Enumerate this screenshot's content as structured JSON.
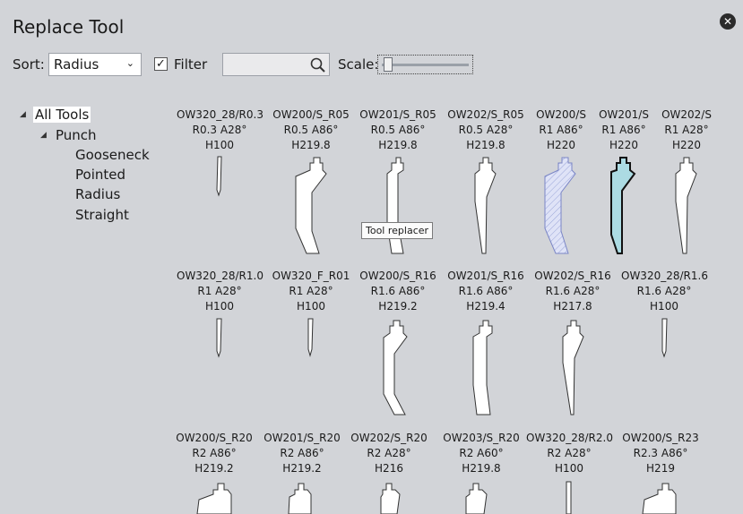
{
  "dialog": {
    "title": "Replace Tool",
    "close_glyph": "✕"
  },
  "toolbar": {
    "sort_label": "Sort:",
    "sort_value": "Radius",
    "filter_label": "Filter",
    "filter_checked": "✓",
    "search_value": "",
    "scale_label": "Scale:"
  },
  "tree": {
    "root": "All Tools",
    "group": "Punch",
    "children": [
      "Gooseneck",
      "Pointed",
      "Radius",
      "Straight"
    ]
  },
  "tooltip": "Tool replacer",
  "tools": [
    {
      "name": "OW320_28/R0.3",
      "spec": "R0.3  A28°",
      "height": "H100"
    },
    {
      "name": "OW200/S_R05",
      "spec": "R0.5  A86°",
      "height": "H219.8"
    },
    {
      "name": "OW201/S_R05",
      "spec": "R0.5  A86°",
      "height": "H219.8"
    },
    {
      "name": "OW202/S_R05",
      "spec": "R0.5  A28°",
      "height": "H219.8"
    },
    {
      "name": "OW200/S",
      "spec": "R1  A86°",
      "height": "H220"
    },
    {
      "name": "OW201/S",
      "spec": "R1  A86°",
      "height": "H220"
    },
    {
      "name": "OW202/S",
      "spec": "R1  A28°",
      "height": "H220"
    },
    {
      "name": "OW320_28/R1.0",
      "spec": "R1  A28°",
      "height": "H100"
    },
    {
      "name": "OW320_F_R01",
      "spec": "R1  A28°",
      "height": "H100"
    },
    {
      "name": "OW200/S_R16",
      "spec": "R1.6  A86°",
      "height": "H219.2"
    },
    {
      "name": "OW201/S_R16",
      "spec": "R1.6  A86°",
      "height": "H219.4"
    },
    {
      "name": "OW202/S_R16",
      "spec": "R1.6  A28°",
      "height": "H217.8"
    },
    {
      "name": "OW320_28/R1.6",
      "spec": "R1.6  A28°",
      "height": "H100"
    },
    {
      "name": "OW200/S_R20",
      "spec": "R2  A86°",
      "height": "H219.2"
    },
    {
      "name": "OW201/S_R20",
      "spec": "R2  A86°",
      "height": "H219.2"
    },
    {
      "name": "OW202/S_R20",
      "spec": "R2  A28°",
      "height": "H216"
    },
    {
      "name": "OW203/S_R20",
      "spec": "R2  A60°",
      "height": "H219.8"
    },
    {
      "name": "OW320_28/R2.0",
      "spec": "R2  A28°",
      "height": "H100"
    },
    {
      "name": "OW200/S_R23",
      "spec": "R2.3  A86°",
      "height": "H219"
    }
  ],
  "colors": {
    "background": "#d2d4d8",
    "hover_fill": "#dfe3f7",
    "selected_fill": "#acdbe3"
  }
}
